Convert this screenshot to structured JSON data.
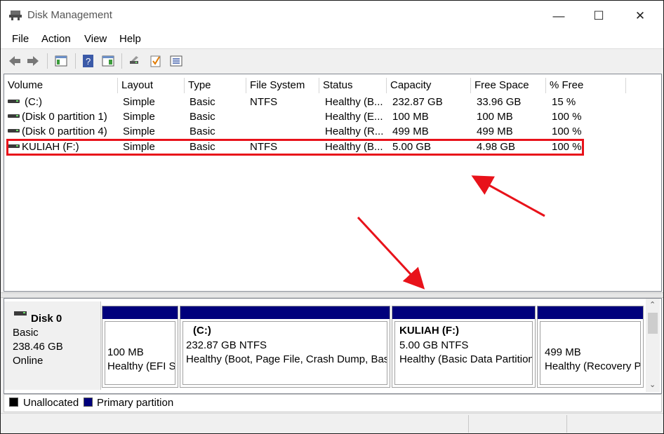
{
  "window": {
    "title": "Disk Management",
    "minimize_glyph": "—",
    "maximize_glyph": "☐",
    "close_glyph": "✕"
  },
  "menu": {
    "items": [
      "File",
      "Action",
      "View",
      "Help"
    ]
  },
  "toolbar": {
    "icons": [
      "back-icon",
      "forward-icon",
      "console-tree-icon",
      "help-icon",
      "properties-pane-icon",
      "rescan-disks-icon",
      "check-icon",
      "settings-list-icon"
    ]
  },
  "volume_list": {
    "columns": [
      "Volume",
      "Layout",
      "Type",
      "File System",
      "Status",
      "Capacity",
      "Free Space",
      "% Free"
    ],
    "rows": [
      [
        "(C:)",
        "Simple",
        "Basic",
        "NTFS",
        "Healthy (B...",
        "232.87 GB",
        "33.96 GB",
        "15 %"
      ],
      [
        "(Disk 0 partition 1)",
        "Simple",
        "Basic",
        "",
        "Healthy (E...",
        "100 MB",
        "100 MB",
        "100 %"
      ],
      [
        "(Disk 0 partition 4)",
        "Simple",
        "Basic",
        "",
        "Healthy (R...",
        "499 MB",
        "499 MB",
        "100 %"
      ],
      [
        "KULIAH (F:)",
        "Simple",
        "Basic",
        "NTFS",
        "Healthy (B...",
        "5.00 GB",
        "4.98 GB",
        "100 %"
      ]
    ],
    "highlighted_row": "KULIAH (F:)"
  },
  "disk": {
    "name": "Disk 0",
    "type": "Basic",
    "size": "238.46 GB",
    "state": "Online",
    "partitions": [
      {
        "label": "",
        "size": "100 MB",
        "status": "Healthy (EFI S"
      },
      {
        "label": "(C:)",
        "size": "232.87 GB NTFS",
        "status": "Healthy (Boot, Page File, Crash Dump, Basi"
      },
      {
        "label": "KULIAH  (F:)",
        "size": "5.00 GB NTFS",
        "status": "Healthy (Basic Data Partition"
      },
      {
        "label": "",
        "size": "499 MB",
        "status": "Healthy (Recovery P"
      }
    ]
  },
  "legend": {
    "unallocated": "Unallocated",
    "primary": "Primary partition"
  },
  "colors": {
    "primary_partition": "#00007c",
    "unallocated": "#000000",
    "annotation": "#e8121a"
  },
  "scroll": {
    "up_glyph": "⌃",
    "down_glyph": "⌄"
  }
}
